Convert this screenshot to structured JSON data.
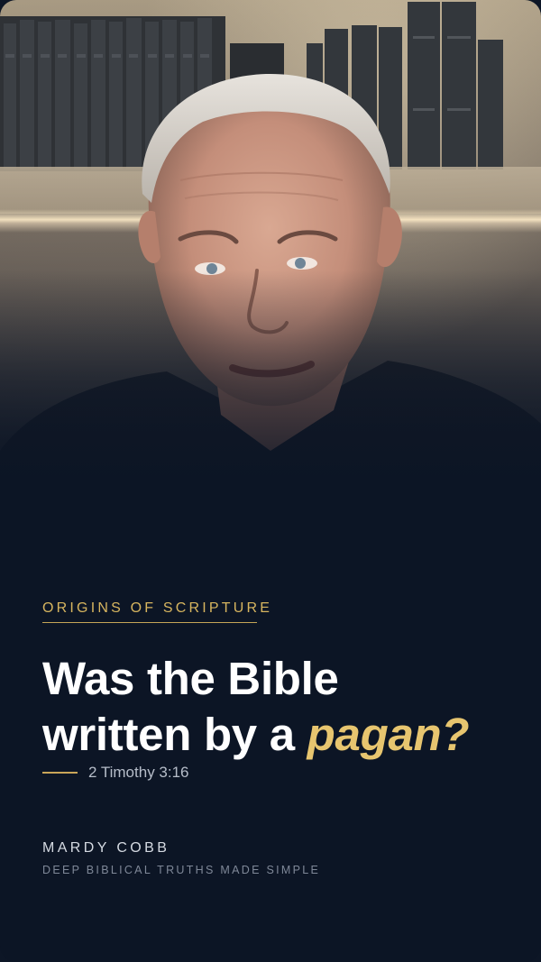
{
  "hero": {
    "image_subject": "man-speaking-in-front-of-bookshelf"
  },
  "story": {
    "eyebrow": "ORIGINS OF SCRIPTURE",
    "headline_line1": "Was the Bible",
    "headline_line2_prefix": "written by a ",
    "headline_accent": "pagan?",
    "verse": "2 Timothy 3:16"
  },
  "footer": {
    "author": "MARDY COBB",
    "tagline": "DEEP BIBLICAL TRUTHS MADE SIMPLE"
  },
  "colors": {
    "background": "#0c1525",
    "accent_gold": "#e7c56f",
    "text_white": "#ffffff",
    "muted_text": "#7f8898"
  }
}
